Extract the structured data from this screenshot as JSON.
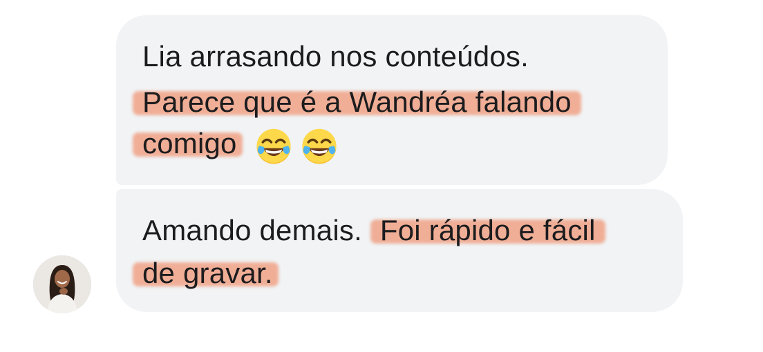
{
  "messages": [
    {
      "lines": [
        "Lia arrasando nos conteúdos.",
        "Parece que é a  Wandréa falando",
        "comigo"
      ],
      "emojis": [
        "face-with-tears-of-joy-icon",
        "face-with-tears-of-joy-icon"
      ]
    },
    {
      "line1_plain": "Amando demais.",
      "line1_highlight": "Foi rápido e fácil",
      "line2": "de gravar."
    }
  ],
  "colors": {
    "bubble": "#f1f3f5",
    "highlight": "#f0a98f",
    "text": "#1c1c1e"
  },
  "avatar": {
    "icon": "user-avatar-photo"
  }
}
